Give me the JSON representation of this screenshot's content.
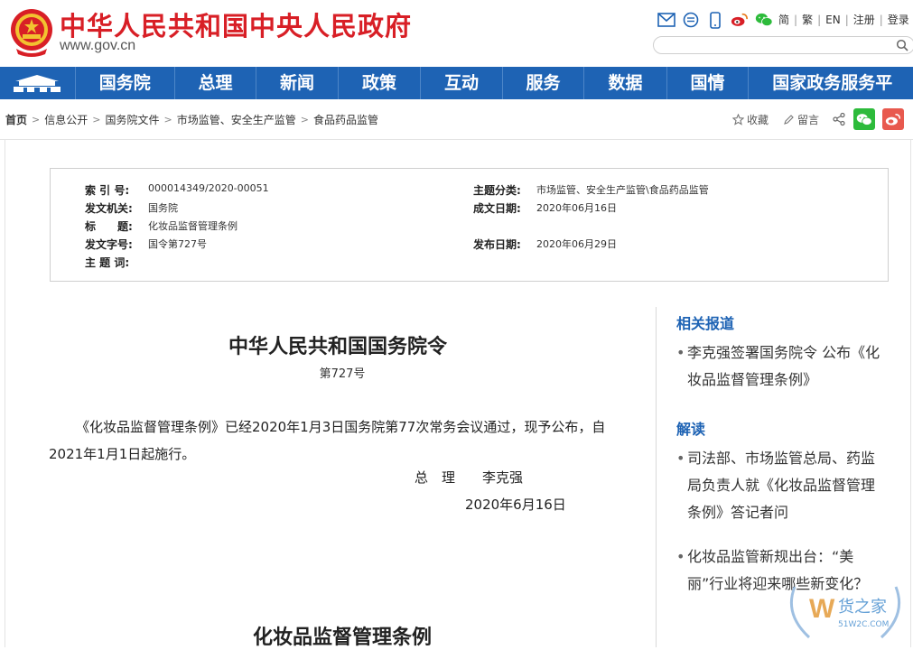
{
  "header": {
    "site_title": "中华人民共和国中央人民政府",
    "site_url": "www.gov.cn",
    "icons": [
      "mail-icon",
      "chat-icon",
      "mobile-icon",
      "weibo-icon",
      "wechat-icon"
    ],
    "links": [
      "简",
      "繁",
      "EN",
      "注册",
      "登录"
    ],
    "search_placeholder": ""
  },
  "nav": {
    "items": [
      "国务院",
      "总理",
      "新闻",
      "政策",
      "互动",
      "服务",
      "数据",
      "国情",
      "国家政务服务平"
    ]
  },
  "breadcrumb": {
    "items": [
      "首页",
      "信息公开",
      "国务院文件",
      "市场监管、安全生产监管",
      "食品药品监管"
    ],
    "tools": {
      "favorite": "收藏",
      "comment": "留言"
    }
  },
  "meta": {
    "index_key": "索 引 号:",
    "index_val": "000014349/2020-00051",
    "topic_key": "主题分类:",
    "topic_val": "市场监管、安全生产监管\\食品药品监管",
    "issuer_key": "发文机关:",
    "issuer_val": "国务院",
    "date_made_key": "成文日期:",
    "date_made_val": "2020年06月16日",
    "title_key": "标　　题:",
    "title_val": "化妆品监督管理条例",
    "docno_key": "发文字号:",
    "docno_val": "国令第727号",
    "pub_key": "发布日期:",
    "pub_val": "2020年06月29日",
    "keywords_key": "主 题 词:",
    "keywords_val": ""
  },
  "article": {
    "title": "中华人民共和国国务院令",
    "number": "第727号",
    "paragraph": "《化妆品监督管理条例》已经2020年1月3日国务院第77次常务会议通过，现予公布，自2021年1月1日起施行。",
    "signer": "总　理　　李克强",
    "sign_date": "2020年6月16日",
    "subtitle": "化妆品监督管理条例"
  },
  "sidebar": {
    "related_heading": "相关报道",
    "related_items": [
      "李克强签署国务院令 公布《化妆品监督管理条例》"
    ],
    "interpret_heading": "解读",
    "interpret_items": [
      "司法部、市场监管总局、药监局负责人就《化妆品监督管理条例》答记者问",
      "化妆品监管新规出台：“美丽”行业将迎来哪些新变化？"
    ]
  },
  "watermark": {
    "text": "货之家",
    "sub": "51W2C.COM"
  },
  "colors": {
    "brand_red": "#d81f26",
    "nav_blue": "#1e63b4",
    "wechat_green": "#2dbb3b",
    "weibo_red": "#e8594e"
  }
}
